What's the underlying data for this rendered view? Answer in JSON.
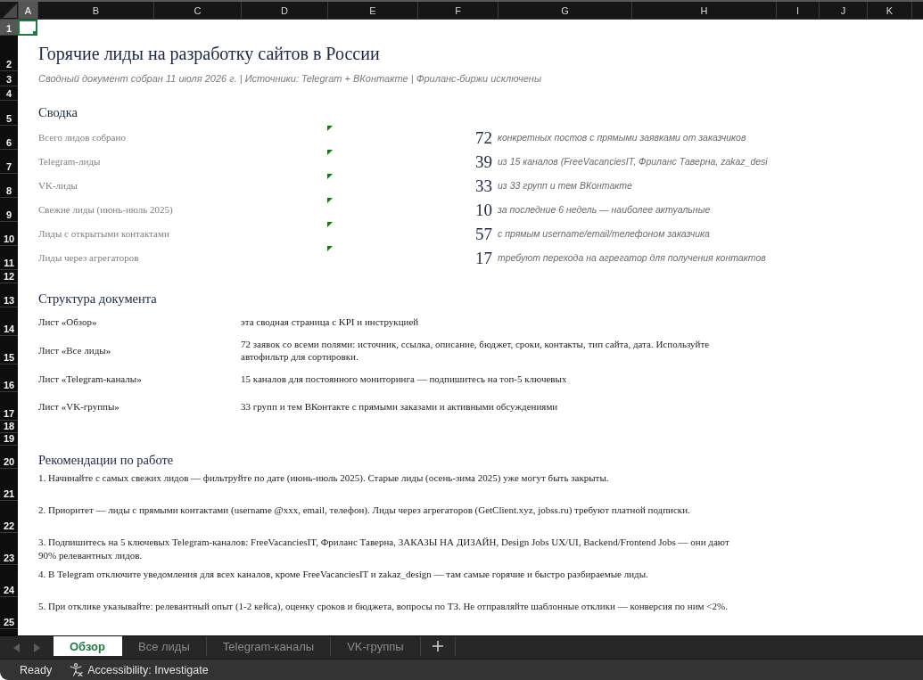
{
  "sheet": {
    "columns": [
      {
        "label": "A",
        "selected": true
      },
      {
        "label": "B",
        "selected": false
      },
      {
        "label": "C",
        "selected": false
      },
      {
        "label": "D",
        "selected": false
      },
      {
        "label": "E",
        "selected": false
      },
      {
        "label": "F",
        "selected": false
      },
      {
        "label": "G",
        "selected": false
      },
      {
        "label": "H",
        "selected": false
      },
      {
        "label": "I",
        "selected": false
      },
      {
        "label": "J",
        "selected": false
      },
      {
        "label": "K",
        "selected": false
      }
    ],
    "rows": [
      {
        "label": "1",
        "selected": true
      },
      {
        "label": "2",
        "selected": false
      },
      {
        "label": "3",
        "selected": false
      },
      {
        "label": "4",
        "selected": false
      },
      {
        "label": "5",
        "selected": false
      },
      {
        "label": "6",
        "selected": false
      },
      {
        "label": "7",
        "selected": false
      },
      {
        "label": "8",
        "selected": false
      },
      {
        "label": "9",
        "selected": false
      },
      {
        "label": "10",
        "selected": false
      },
      {
        "label": "11",
        "selected": false
      },
      {
        "label": "12",
        "selected": false
      },
      {
        "label": "13",
        "selected": false
      },
      {
        "label": "14",
        "selected": false
      },
      {
        "label": "15",
        "selected": false
      },
      {
        "label": "16",
        "selected": false
      },
      {
        "label": "17",
        "selected": false
      },
      {
        "label": "18",
        "selected": false
      },
      {
        "label": "19",
        "selected": false
      },
      {
        "label": "20",
        "selected": false
      },
      {
        "label": "21",
        "selected": false
      },
      {
        "label": "22",
        "selected": false
      },
      {
        "label": "23",
        "selected": false
      },
      {
        "label": "24",
        "selected": false
      },
      {
        "label": "25",
        "selected": false
      }
    ]
  },
  "title": "Горячие лиды на разработку сайтов в России",
  "subtitle": "Сводный документ собран 11 июля 2026 г. | Источники: Telegram + ВКонтакте | Фриланс-биржи исключены",
  "summary": {
    "heading": "Сводка",
    "items": [
      {
        "label": "Всего лидов собрано",
        "flagged": true,
        "value": "72",
        "note": "конкретных постов с прямыми заявками от заказчиков"
      },
      {
        "label": "Telegram-лиды",
        "flagged": true,
        "value": "39",
        "note": "из 15 каналов (FreeVacanciesIT, Фриланс Таверна, zakaz_desi"
      },
      {
        "label": "VK-лиды",
        "flagged": true,
        "value": "33",
        "note": "из 33 групп и тем ВКонтакте"
      },
      {
        "label": "Свежие лиды (июнь-июль 2025)",
        "flagged": true,
        "value": "10",
        "note": "за последние 6 недель — наиболее актуальные"
      },
      {
        "label": "Лиды с открытыми контактами",
        "flagged": true,
        "value": "57",
        "note": "с прямым username/email/телефоном заказчика"
      },
      {
        "label": "Лиды через агрегаторов",
        "flagged": true,
        "value": "17",
        "note": "требуют перехода на агрегатор для получения контактов"
      }
    ]
  },
  "structure": {
    "heading": "Структура документа",
    "items": [
      {
        "sheet": "Лист «Обзор»",
        "description": "эта сводная страница с KPI и инструкцией"
      },
      {
        "sheet": "Лист «Все лиды»",
        "description": "72 заявок со всеми полями: источник, ссылка, описание, бюджет, сроки, контакты, тип сайта, дата. Используйте автофильтр для сортировки."
      },
      {
        "sheet": "Лист «Telegram-каналы»",
        "description": "15 каналов для постоянного мониторинга — подпишитесь на топ-5 ключевых"
      },
      {
        "sheet": "Лист «VK-группы»",
        "description": "33 групп и тем ВКонтакте с прямыми заказами и активными обсуждениями"
      }
    ]
  },
  "recommendations": {
    "heading": "Рекомендации по работе",
    "items": [
      "1. Начинайте с самых свежих лидов — фильтруйте по дате (июнь-июль 2025). Старые лиды (осень-зима 2025) уже могут быть закрыты.",
      "2. Приоритет — лиды с прямыми контактами (username @xxx, email, телефон). Лиды через агрегаторов (GetClient.xyz, jobss.ru) требуют платной подписки.",
      "3. Подпишитесь на 5 ключевых Telegram-каналов: FreeVacanciesIT, Фриланс Таверна, ЗАКАЗЫ НА ДИЗАЙН, Design Jobs UX/UI, Backend/Frontend Jobs — они дают 90% релевантных лидов.",
      "4. В Telegram отключите уведомления для всех каналов, кроме FreeVacanciesIT и zakaz_design — там самые горячие и быстро разбираемые лиды.",
      "5. При отклике указывайте: релевантный опыт (1-2 кейса), оценку сроков и бюджета, вопросы по ТЗ. Не отправляйте шаблонные отклики — конверсия по ним <2%."
    ]
  },
  "sheet_tabs": [
    {
      "label": "Обзор",
      "selected": true
    },
    {
      "label": "Все лиды",
      "selected": false
    },
    {
      "label": "Telegram-каналы",
      "selected": false
    },
    {
      "label": "VK-группы",
      "selected": false
    }
  ],
  "status_bar": {
    "status": "Ready",
    "accessibility": "Accessibility: Investigate"
  }
}
